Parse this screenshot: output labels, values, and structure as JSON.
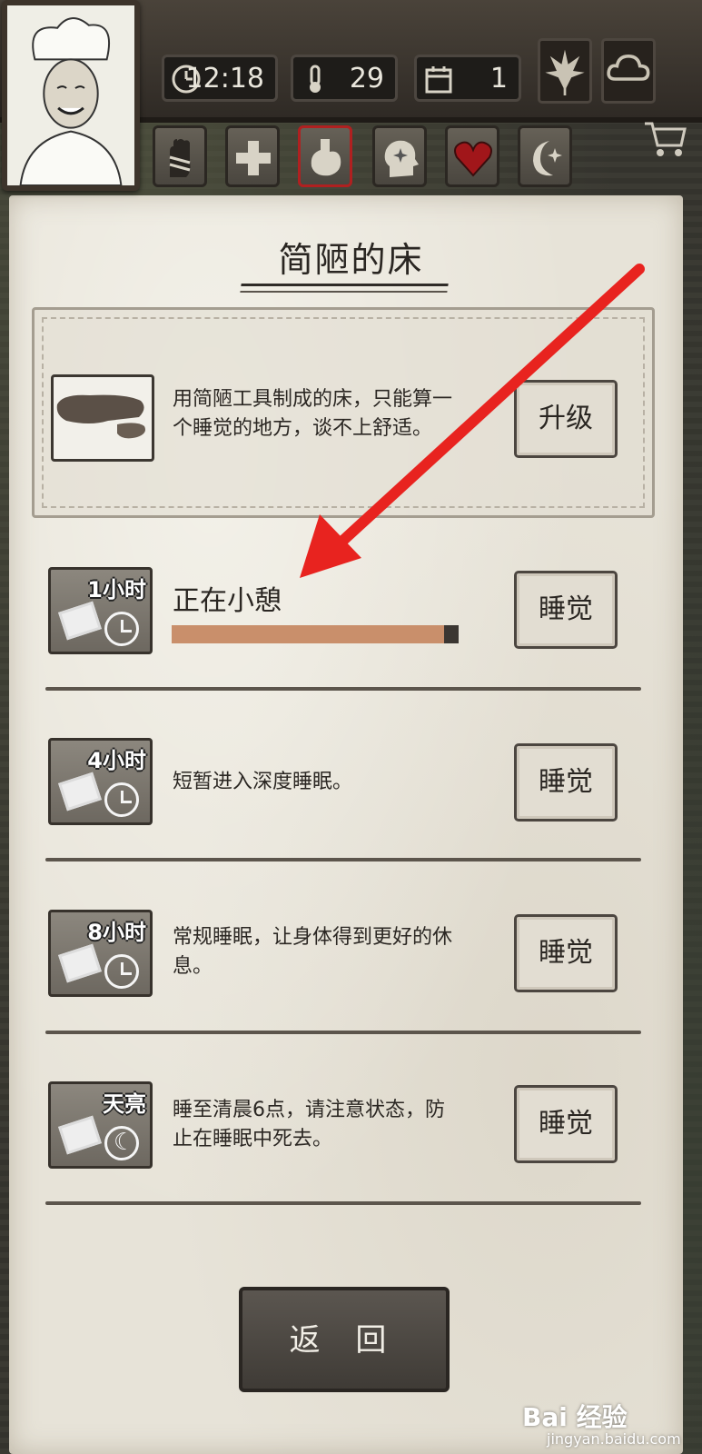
{
  "status": {
    "time": "12:18",
    "temperature": "29",
    "day": "1"
  },
  "tabs": [
    "hand-tab",
    "health-tab",
    "stomach-tab",
    "mind-tab",
    "heart-tab",
    "sleep-tab"
  ],
  "active_tab": "stomach-tab",
  "page": {
    "title": "简陋的床"
  },
  "bed": {
    "description_line1": "用简陋工具制成的床，只能算一",
    "description_line2": "个睡觉的地方，谈不上舒适。",
    "upgrade_label": "升级"
  },
  "options": [
    {
      "badge": "1小时",
      "title": "正在小憩",
      "progress": 0.95,
      "button": "睡觉"
    },
    {
      "badge": "4小时",
      "description": "短暂进入深度睡眠。",
      "button": "睡觉"
    },
    {
      "badge": "8小时",
      "description_line1": "常规睡眠，让身体得到更好的休",
      "description_line2": "息。",
      "button": "睡觉"
    },
    {
      "badge": "天亮",
      "description_line1": "睡至清晨6点，请注意状态，防",
      "description_line2": "止在睡眠中死去。",
      "button": "睡觉"
    }
  ],
  "back_label": "返 回",
  "watermark": {
    "brand": "Bai 经验",
    "url": "jingyan.baidu.com"
  },
  "colors": {
    "progress_fill": "#c98f6b",
    "progress_track": "#3b3632",
    "annotation_arrow": "#e8231f",
    "active_tab_border": "#b02020"
  }
}
